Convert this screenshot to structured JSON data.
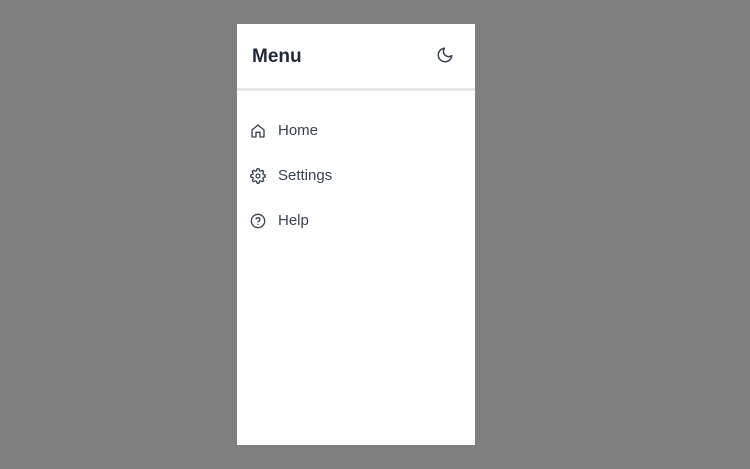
{
  "menu": {
    "title": "Menu",
    "theme_toggle_icon": "moon-icon",
    "items": [
      {
        "label": "Home",
        "icon": "home-icon"
      },
      {
        "label": "Settings",
        "icon": "gear-icon"
      },
      {
        "label": "Help",
        "icon": "help-circle-icon"
      }
    ]
  },
  "colors": {
    "backdrop": "#808080",
    "panel": "#ffffff",
    "title": "#1f2937",
    "text": "#374151",
    "divider": "#e5e7eb"
  }
}
